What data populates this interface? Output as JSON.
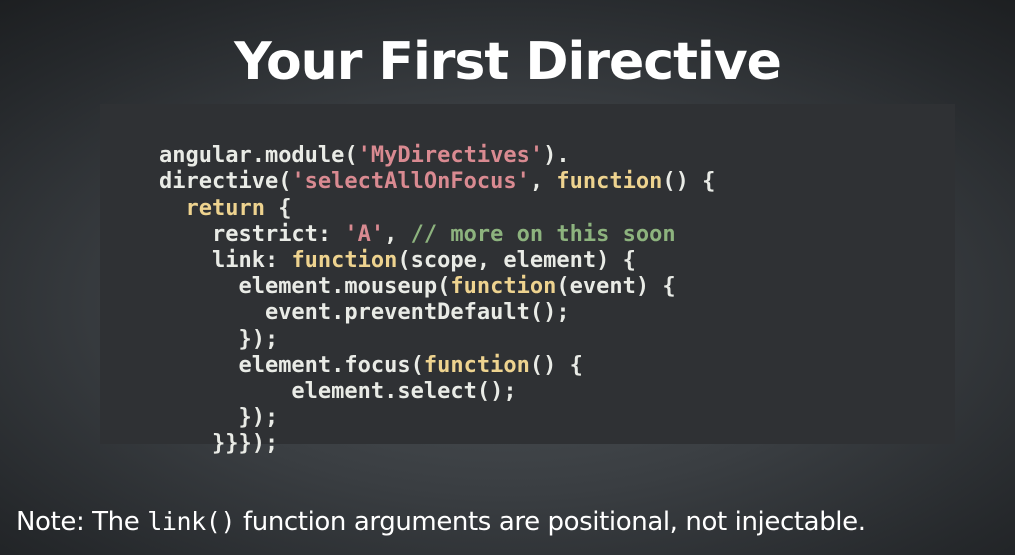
{
  "slide": {
    "title": "Your First Directive"
  },
  "code": {
    "lines": [
      [
        {
          "t": "plain",
          "v": "angular.module("
        },
        {
          "t": "string",
          "v": "'MyDirectives'"
        },
        {
          "t": "plain",
          "v": ")."
        }
      ],
      [
        {
          "t": "plain",
          "v": "directive("
        },
        {
          "t": "string",
          "v": "'selectAllOnFocus'"
        },
        {
          "t": "plain",
          "v": ", "
        },
        {
          "t": "keyword",
          "v": "function"
        },
        {
          "t": "plain",
          "v": "() {"
        }
      ],
      [
        {
          "t": "plain",
          "v": "  "
        },
        {
          "t": "keyword",
          "v": "return"
        },
        {
          "t": "plain",
          "v": " {"
        }
      ],
      [
        {
          "t": "plain",
          "v": "    restrict: "
        },
        {
          "t": "string",
          "v": "'A'"
        },
        {
          "t": "plain",
          "v": ", "
        },
        {
          "t": "comment",
          "v": "// more on this soon"
        }
      ],
      [
        {
          "t": "plain",
          "v": "    link: "
        },
        {
          "t": "keyword",
          "v": "function"
        },
        {
          "t": "plain",
          "v": "(scope, element) {"
        }
      ],
      [
        {
          "t": "plain",
          "v": "      element.mouseup("
        },
        {
          "t": "keyword",
          "v": "function"
        },
        {
          "t": "plain",
          "v": "(event) {"
        }
      ],
      [
        {
          "t": "plain",
          "v": "        event.preventDefault();"
        }
      ],
      [
        {
          "t": "plain",
          "v": "      });"
        }
      ],
      [
        {
          "t": "plain",
          "v": "      element.focus("
        },
        {
          "t": "keyword",
          "v": "function"
        },
        {
          "t": "plain",
          "v": "() {"
        }
      ],
      [
        {
          "t": "plain",
          "v": "          element.select();"
        }
      ],
      [
        {
          "t": "plain",
          "v": "      });"
        }
      ],
      [
        {
          "t": "plain",
          "v": "    }}});"
        }
      ]
    ]
  },
  "note": {
    "prefix": "Note: The ",
    "code": "link()",
    "suffix": " function arguments are positional, not injectable."
  },
  "colors": {
    "plain": "#e9ebe6",
    "string": "#d98a91",
    "keyword": "#eed38f",
    "comment": "#8db37e",
    "code_background": "#2f3134"
  }
}
